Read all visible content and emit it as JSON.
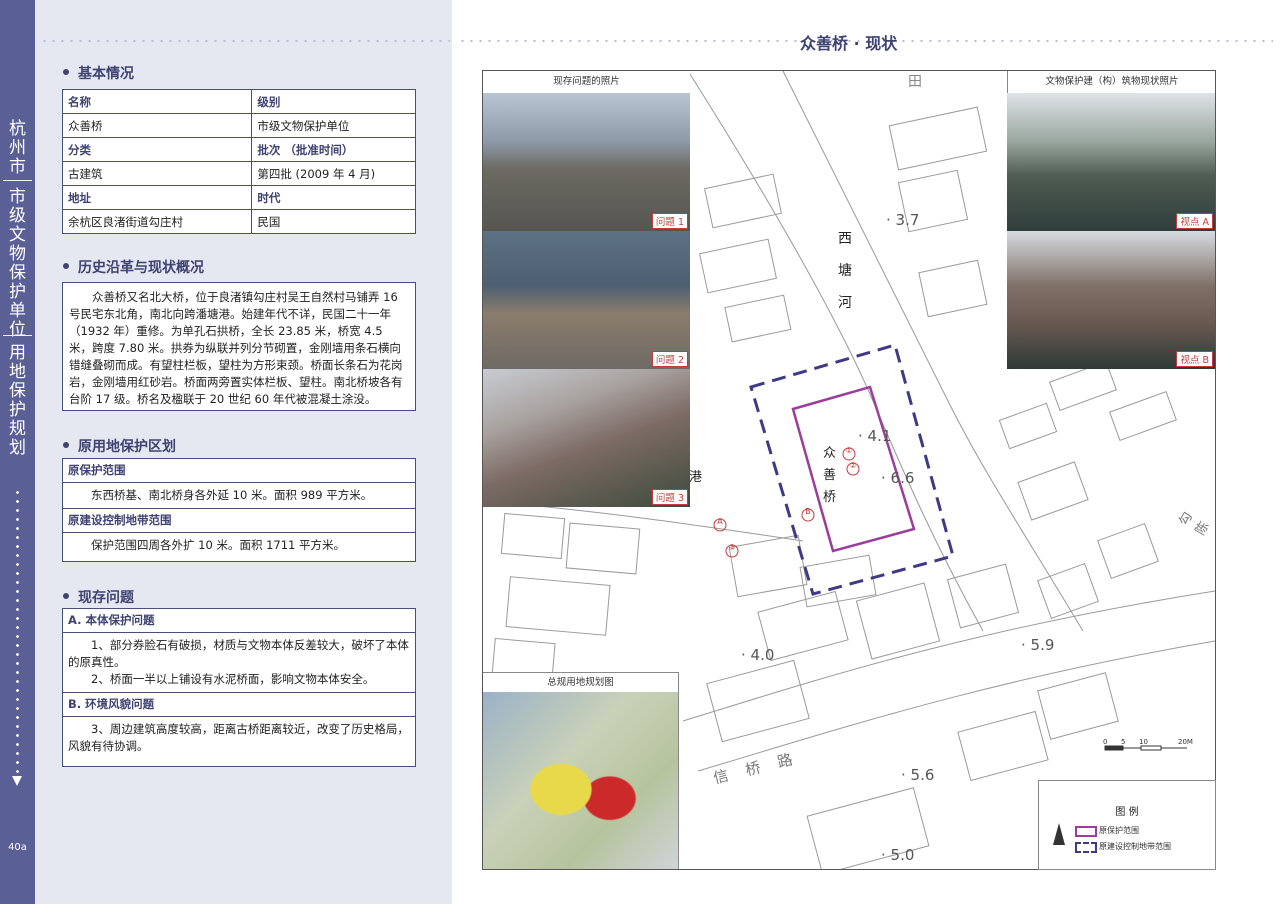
{
  "sidebar": {
    "city": "杭州市",
    "category": "市级文物保护单位",
    "topic": "用地保护规划",
    "page_number": "40a"
  },
  "page_title": "众善桥 · 现状",
  "basic_info": {
    "title": "基本情况",
    "rows": [
      {
        "k1": "名称",
        "k2": "级别",
        "header": true
      },
      {
        "k1": "众善桥",
        "k2": "市级文物保护单位",
        "header": false
      },
      {
        "k1": "分类",
        "k2": "批次 （批准时间）",
        "header": true
      },
      {
        "k1": "古建筑",
        "k2": "第四批 (2009 年 4 月)",
        "header": false
      },
      {
        "k1": "地址",
        "k2": "时代",
        "header": true
      },
      {
        "k1": "余杭区良渚街道勾庄村",
        "k2": "民国",
        "header": false
      }
    ]
  },
  "history": {
    "title": "历史沿革与现状概况",
    "text": "众善桥又名北大桥，位于良渚镇勾庄村吴王自然村马铺弄 16 号民宅东北角，南北向跨潘塘港。始建年代不详，民国二十一年（1932 年）重修。为单孔石拱桥，全长 23.85 米，桥宽 4.5 米，跨度 7.80 米。拱券为纵联并列分节砌置，金刚墙用条石横向错缝叠砌而成。有望柱栏板，望柱为方形束颈。桥面长条石为花岗岩，金刚墙用红砂岩。桥面两旁置实体栏板、望柱。南北桥坡各有台阶 17 级。桥名及楹联于 20 世纪 60 年代被混凝土涂没。"
  },
  "original_zoning": {
    "title": "原用地保护区划",
    "protect_label": "原保护范围",
    "protect_text": "东西桥基、南北桥身各外延 10 米。面积 989 平方米。",
    "control_label": "原建设控制地带范围",
    "control_text": "保护范围四周各外扩 10 米。面积 1711 平方米。"
  },
  "issues": {
    "title": "现存问题",
    "a_label": "A. 本体保护问题",
    "a_text1": "1、部分券脸石有破损，材质与文物本体反差较大，破坏了本体的原真性。",
    "a_text2": "2、桥面一半以上铺设有水泥桥面，影响文物本体安全。",
    "b_label": "B. 环境风貌问题",
    "b_text1": "3、周边建筑高度较高，距离古桥距离较近，改变了历史格局，风貌有待协调。"
  },
  "map": {
    "left_photos_caption": "现存问题的照片",
    "right_photos_caption": "文物保护建（构）筑物现状照片",
    "photo_labels": [
      "问题 1",
      "问题 2",
      "问题 3",
      "视点 A",
      "视点 B"
    ],
    "landuse_caption": "总规用地规划图",
    "river_label": "西塘河",
    "bridge_label": "众善桥",
    "field_label": "田",
    "port_label": "港",
    "road_label": "信桥路",
    "road_label2": "勾陈",
    "spot_heights": [
      "3.7",
      "4.0",
      "5.9",
      "5.6",
      "5.0",
      "6.6",
      "4.1"
    ],
    "markers": [
      "①",
      "②",
      "③",
      "A",
      "B"
    ],
    "scale_ticks": [
      "0",
      "5",
      "10",
      "20M"
    ],
    "legend_title": "图 例",
    "legend_items": [
      "原保护范围",
      "原建设控制地带范围"
    ],
    "protect_color": "#9b3d9b",
    "control_color": "#3f3a85"
  }
}
